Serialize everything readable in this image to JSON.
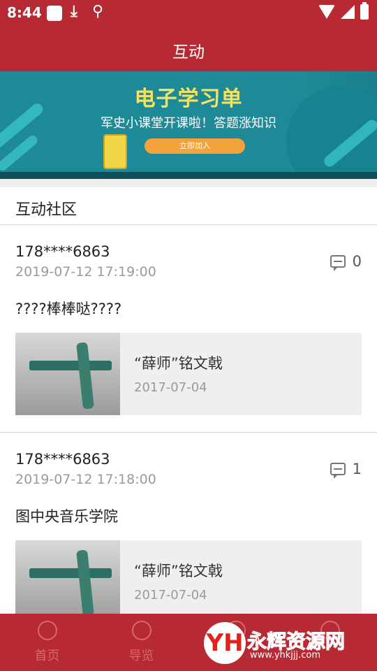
{
  "status_bar": {
    "time": "8:44",
    "icons": [
      "square-icon",
      "download-icon",
      "bug-icon",
      "wifi-icon",
      "signal-icon",
      "battery-icon"
    ]
  },
  "header": {
    "title": "互动"
  },
  "banner": {
    "title": "电子学习单",
    "subtitle": "军史小课堂开课啦！答题涨知识",
    "button": "立即加入"
  },
  "section": {
    "title": "互动社区"
  },
  "posts": [
    {
      "user": "178****6863",
      "time": "2019-07-12 17:19:00",
      "comments": "0",
      "content": "????棒棒哒????",
      "card": {
        "title": "“薛师”铭文戟",
        "date": "2017-07-04"
      }
    },
    {
      "user": "178****6863",
      "time": "2019-07-12 17:18:00",
      "comments": "1",
      "content": "图中央音乐学院",
      "card": {
        "title": "“薛师”铭文戟",
        "date": "2017-07-04"
      }
    }
  ],
  "tab_bar": {
    "tabs": [
      {
        "label": "首页",
        "icon": "star-icon"
      },
      {
        "label": "导览",
        "icon": "compass-icon"
      },
      {
        "label": "",
        "icon": "interact-icon"
      },
      {
        "label": "",
        "icon": "profile-icon"
      }
    ]
  },
  "watermark": {
    "logo": "YH",
    "text": "永辉资源网",
    "url": "www.yhkjjj.com"
  },
  "colors": {
    "primary": "#b72a33",
    "banner": "#1f8a97",
    "accent": "#f4a33a"
  }
}
